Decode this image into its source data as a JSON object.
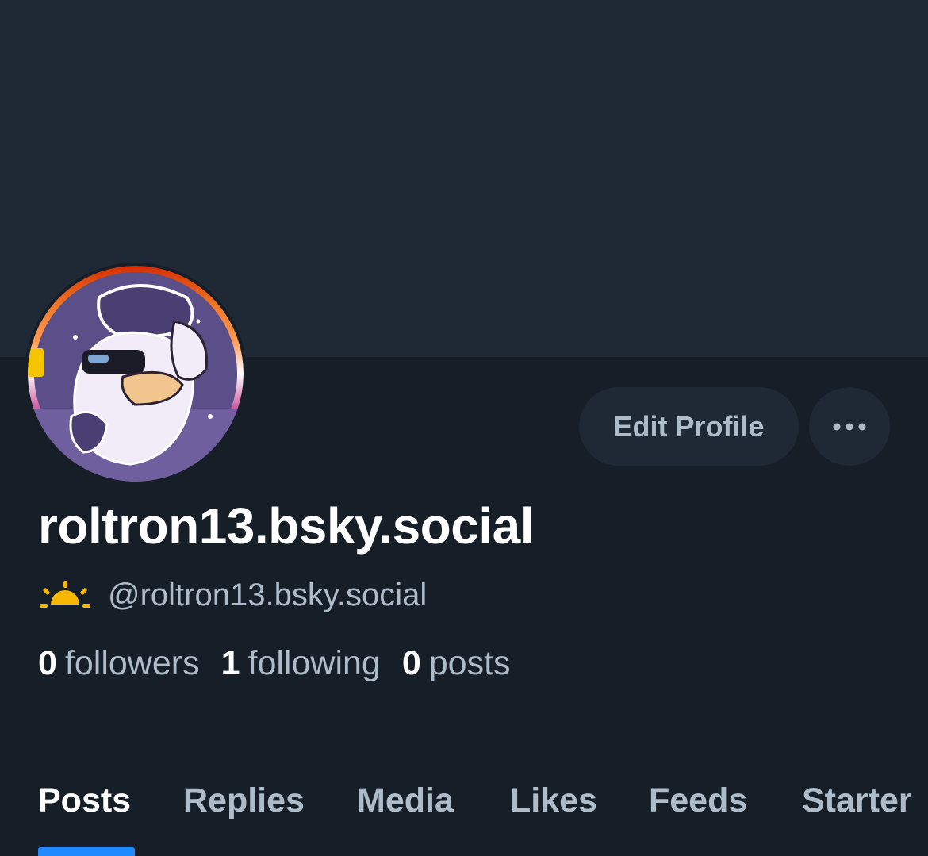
{
  "profile": {
    "display_name": "roltron13.bsky.social",
    "handle": "@roltron13.bsky.social",
    "handle_icon": "sunrise-icon",
    "edit_button_label": "Edit Profile",
    "more_button_icon": "ellipsis-icon"
  },
  "stats": [
    {
      "count": "0",
      "label": "followers"
    },
    {
      "count": "1",
      "label": "following"
    },
    {
      "count": "0",
      "label": "posts"
    }
  ],
  "tabs": [
    {
      "label": "Posts",
      "active": true
    },
    {
      "label": "Replies",
      "active": false
    },
    {
      "label": "Media",
      "active": false
    },
    {
      "label": "Likes",
      "active": false
    },
    {
      "label": "Feeds",
      "active": false
    },
    {
      "label": "Starter",
      "active": false
    }
  ],
  "colors": {
    "background": "#161e27",
    "banner": "#1e2935",
    "button_bg": "#1e2935",
    "muted_text": "#aebbc9",
    "accent": "#208bfe",
    "sun_icon": "#f5b700"
  }
}
